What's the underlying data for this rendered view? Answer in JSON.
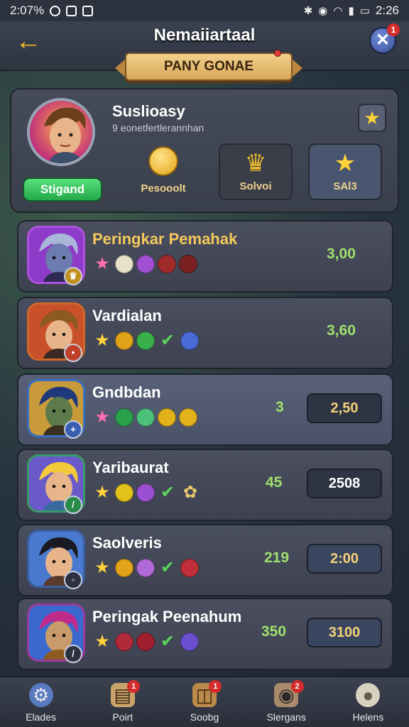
{
  "status_bar": {
    "time_left": "2:07%",
    "time_right": "2:26"
  },
  "header": {
    "title": "Nemaiiartaal",
    "close_badge": "1"
  },
  "banner": {
    "text": "PANY GONAE"
  },
  "profile": {
    "name": "Suslioasy",
    "subtitle": "9 eonetfertlerannhan",
    "rank_label": "Stigand",
    "stats": [
      {
        "label": "Pesooolt",
        "icon": "coin-icon"
      },
      {
        "label": "Solvoi",
        "icon": "crown-icon"
      },
      {
        "label": "SAl3",
        "icon": "star-icon"
      }
    ]
  },
  "leaderboard": [
    {
      "name": "Peringkar Pemahak",
      "score": "3,00",
      "button": "",
      "level": "",
      "colors": {
        "accent": "#b050e0"
      }
    },
    {
      "name": "Vardialan",
      "score": "3,60",
      "button": "",
      "level": "",
      "colors": {
        "accent": "#d2672a"
      }
    },
    {
      "name": "Gndbdan",
      "score": "3",
      "button": "2,50",
      "level": "",
      "colors": {
        "accent": "#3a6fc0"
      }
    },
    {
      "name": "Yaribaurat",
      "score": "45",
      "button": "2508",
      "level": "",
      "colors": {
        "accent": "#3a9a6a"
      }
    },
    {
      "name": "Saolveris",
      "score": "219",
      "button": "2:00",
      "level": "",
      "colors": {
        "accent": "#3a5fa0"
      }
    },
    {
      "name": "Peringak Peenahum",
      "score": "350",
      "button": "3100",
      "level": "",
      "colors": {
        "accent": "#9a3aa0"
      }
    }
  ],
  "bottom_nav": [
    {
      "label": "Elades",
      "icon": "gear-icon",
      "badge": ""
    },
    {
      "label": "Poirt",
      "icon": "card-icon",
      "badge": "1"
    },
    {
      "label": "Soobg",
      "icon": "bag-icon",
      "badge": "1"
    },
    {
      "label": "Slergans",
      "icon": "chest-icon",
      "badge": "2"
    },
    {
      "label": "Helens",
      "icon": "profile-icon",
      "badge": ""
    }
  ]
}
